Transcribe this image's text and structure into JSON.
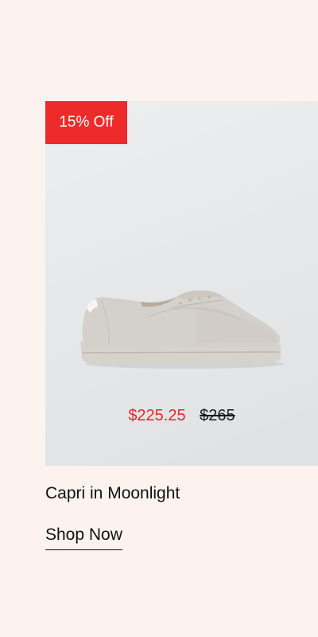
{
  "product": {
    "badge": "15% Off",
    "name": "Capri in Moonlight",
    "image_name": "suede-sneaker-image",
    "price": {
      "sale": "$225.25",
      "original": "$265"
    },
    "cta_label": "Shop Now"
  },
  "colors": {
    "background": "#fcf3ee",
    "badge": "#ee2b2b",
    "sale_price": "#e8262a",
    "text": "#111111"
  }
}
